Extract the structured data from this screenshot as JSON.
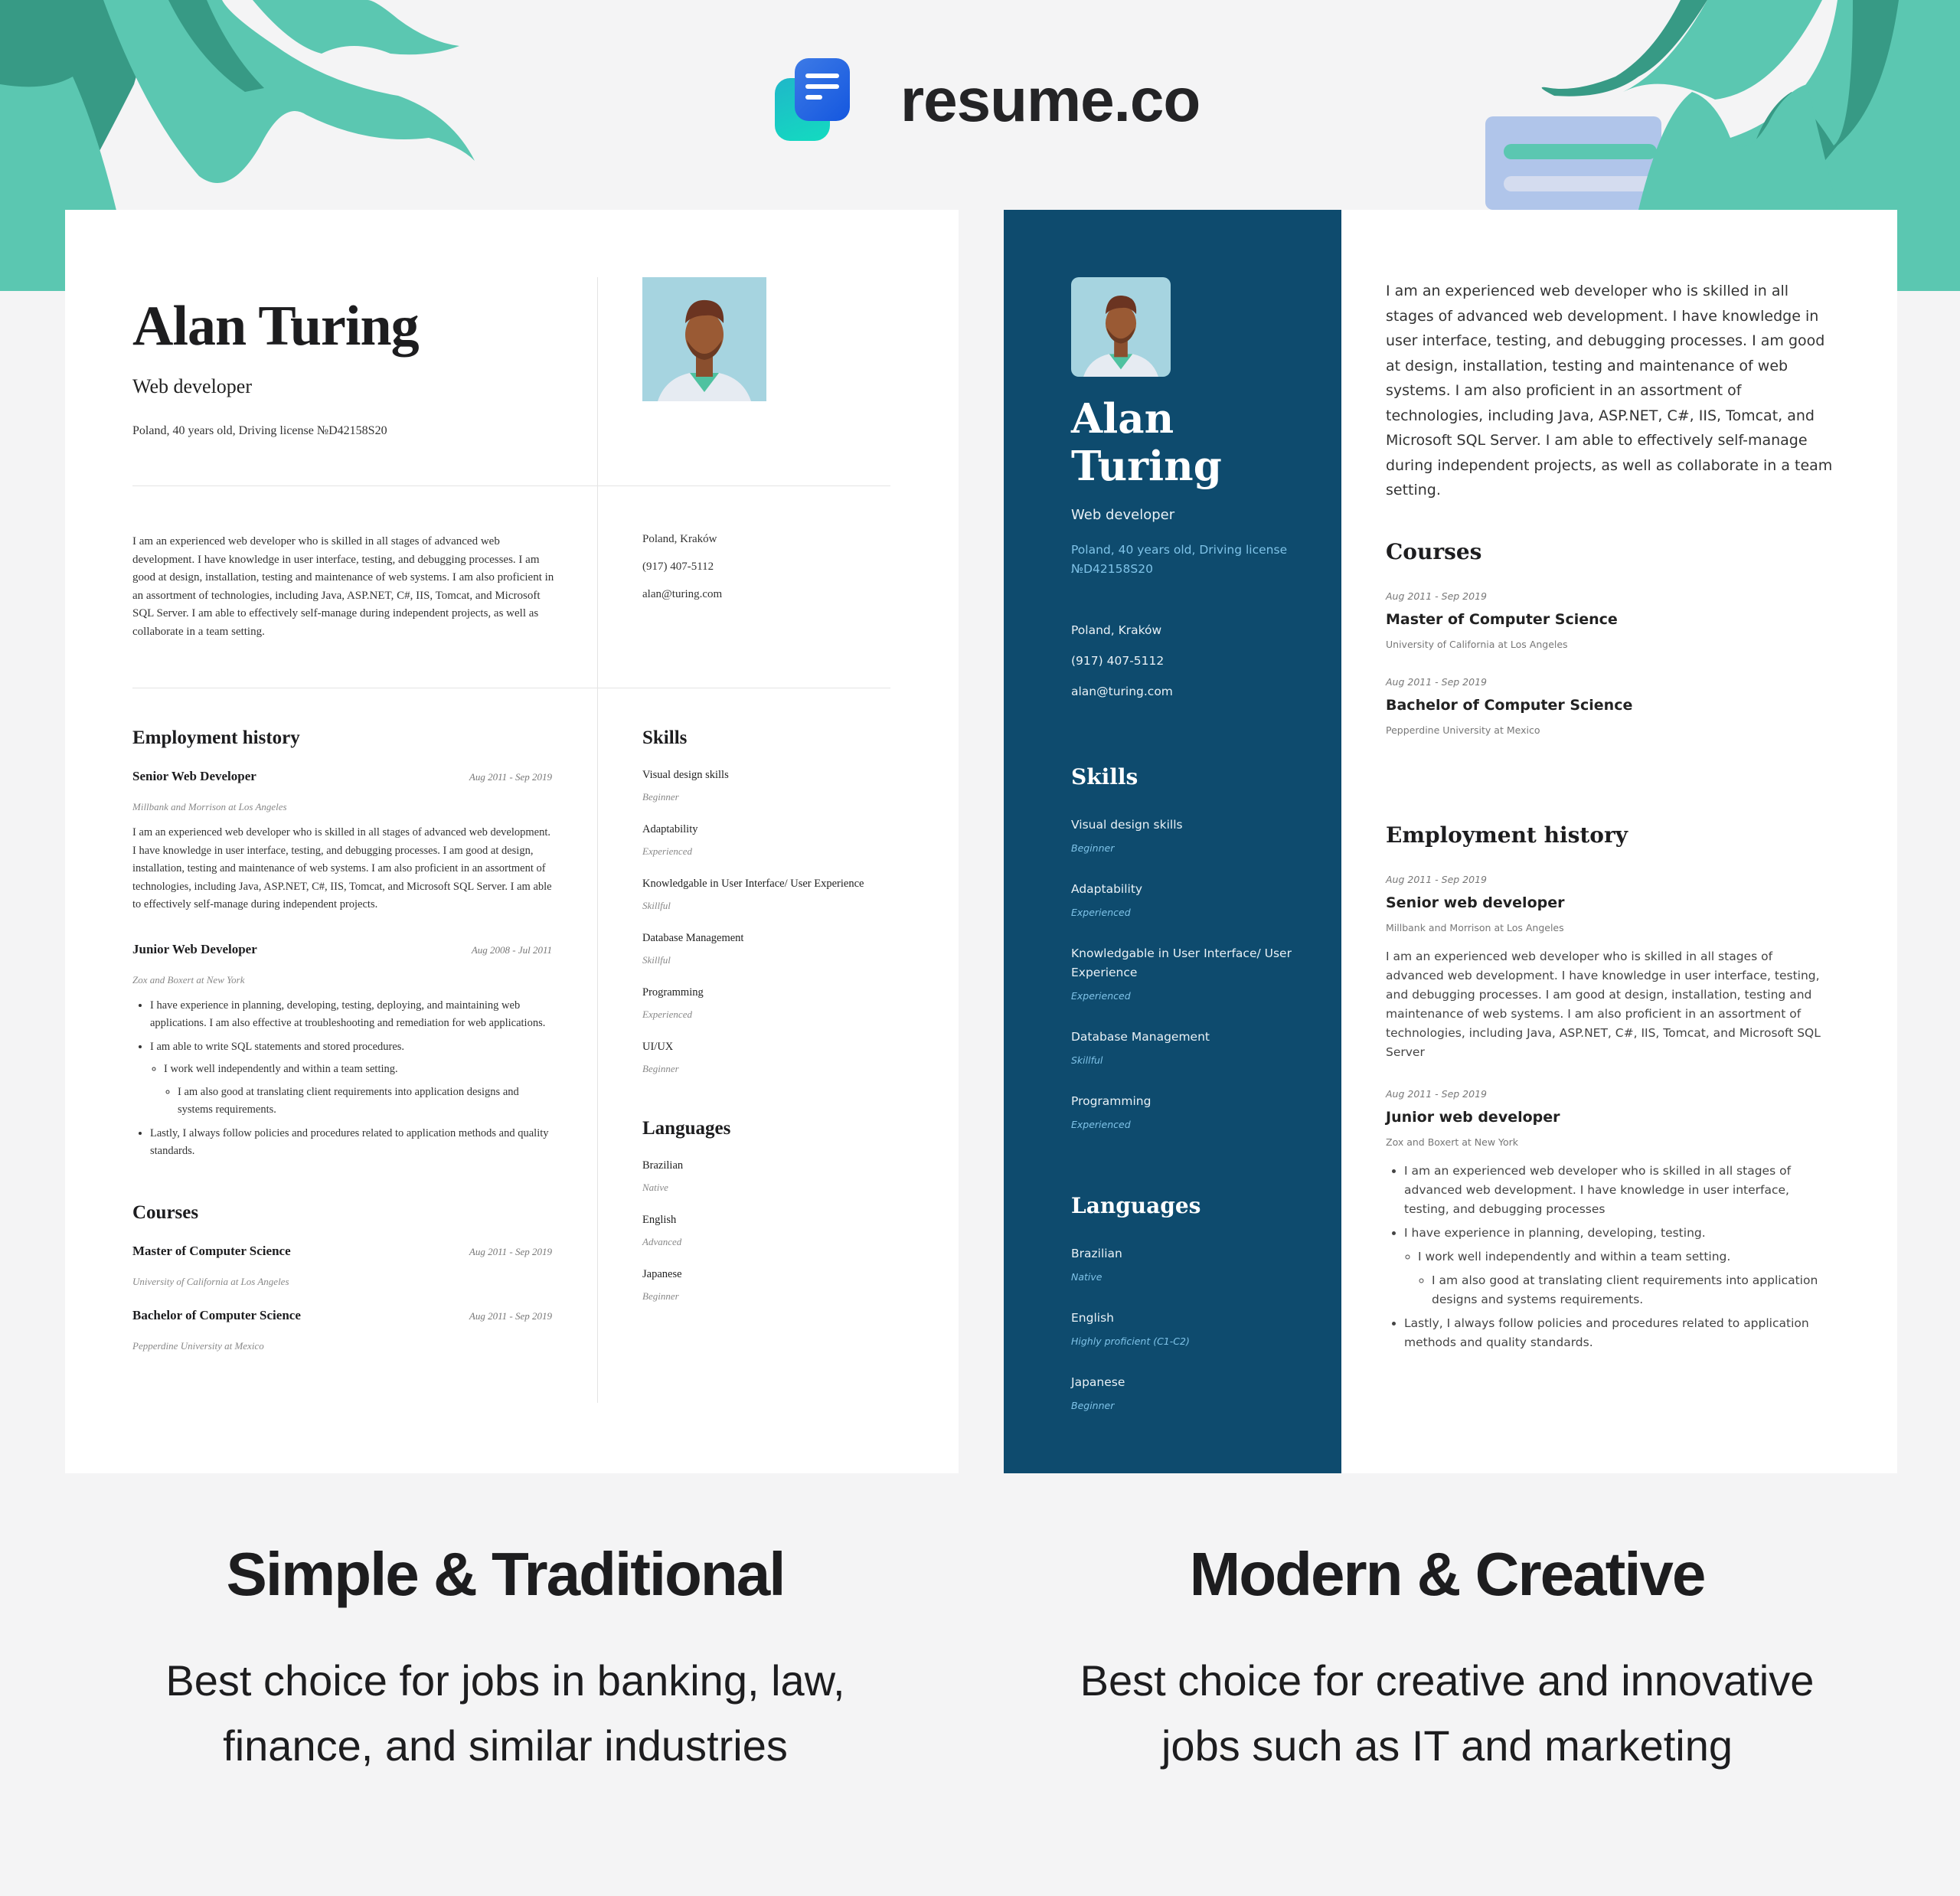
{
  "brand": {
    "name": "resume.co",
    "icon": "resume-logo-icon"
  },
  "colors": {
    "teal": "#5bc7b1",
    "teal_dark": "#379a85",
    "navy": "#0e4b6e",
    "sidebar_accent": "#7fc3e8",
    "logo_blue": "#1457df",
    "logo_cyan": "#13dbc0",
    "bg": "#f4f4f5"
  },
  "traditional": {
    "name": "Alan Turing",
    "role": "Web developer",
    "meta": "Poland, 40 years old, Driving license №D42158S20",
    "summary": "I am an experienced web developer who is skilled in all stages of advanced web development. I have knowledge in user interface, testing, and debugging processes. I am good at design, installation, testing and maintenance of web systems. I am also proficient in an assortment of technologies, including Java, ASP.NET, C#, IIS, Tomcat, and Microsoft SQL Server. I am able to effectively self-manage during independent projects, as well as collaborate in a team setting.",
    "contact": [
      "Poland, Kraków",
      "(917) 407-5112",
      "alan@turing.com"
    ],
    "employment_heading": "Employment history",
    "jobs": [
      {
        "title": "Senior Web Developer",
        "dates": "Aug 2011 - Sep 2019",
        "company": "Millbank and Morrison at Los Angeles",
        "body": "I am an experienced web developer who is skilled in all stages of advanced web development. I have knowledge in user interface, testing, and debugging processes. I am good at design, installation, testing and maintenance of web systems. I am also proficient in an assortment of technologies, including Java, ASP.NET, C#, IIS, Tomcat, and Microsoft SQL Server. I am able to effectively self-manage during independent projects."
      },
      {
        "title": "Junior Web Developer",
        "dates": "Aug 2008 - Jul 2011",
        "company": "Zox and Boxert at New York",
        "bullets": [
          "I have experience in planning, developing, testing, deploying, and maintaining web applications. I am also effective at troubleshooting and remediation for web applications.",
          "I am able to write SQL statements and stored procedures.",
          "I work well independently and within a team setting.",
          "I am also good at translating client requirements into application designs and systems requirements.",
          "Lastly, I always follow policies and procedures related to application methods and quality standards."
        ]
      }
    ],
    "courses_heading": "Courses",
    "courses": [
      {
        "title": "Master of Computer Science",
        "dates": "Aug 2011 - Sep 2019",
        "school": "University of California at Los Angeles"
      },
      {
        "title": "Bachelor of Computer Science",
        "dates": "Aug 2011 - Sep 2019",
        "school": "Pepperdine University at Mexico"
      }
    ],
    "skills_heading": "Skills",
    "skills": [
      {
        "name": "Visual design skills",
        "level": "Beginner"
      },
      {
        "name": "Adaptability",
        "level": "Experienced"
      },
      {
        "name": "Knowledgable in User Interface/ User Experience",
        "level": "Skillful"
      },
      {
        "name": "Database Management",
        "level": "Skillful"
      },
      {
        "name": "Programming",
        "level": "Experienced"
      },
      {
        "name": "UI/UX",
        "level": "Beginner"
      }
    ],
    "languages_heading": "Languages",
    "languages": [
      {
        "name": "Brazilian",
        "level": "Native"
      },
      {
        "name": "English",
        "level": "Advanced"
      },
      {
        "name": "Japanese",
        "level": "Beginner"
      }
    ]
  },
  "modern": {
    "name_first": "Alan",
    "name_last": "Turing",
    "role": "Web developer",
    "meta": "Poland, 40 years old, Driving license №D42158S20",
    "contact": [
      "Poland, Kraków",
      "(917) 407-5112",
      "alan@turing.com"
    ],
    "skills_heading": "Skills",
    "skills": [
      {
        "name": "Visual design skills",
        "level": "Beginner"
      },
      {
        "name": "Adaptability",
        "level": "Experienced"
      },
      {
        "name": "Knowledgable in User Interface/ User Experience",
        "level": "Experienced"
      },
      {
        "name": "Database Management",
        "level": "Skillful"
      },
      {
        "name": "Programming",
        "level": "Experienced"
      }
    ],
    "languages_heading": "Languages",
    "languages": [
      {
        "name": "Brazilian",
        "level": "Native"
      },
      {
        "name": "English",
        "level": "Highly proficient (C1-C2)"
      },
      {
        "name": "Japanese",
        "level": "Beginner"
      }
    ],
    "summary": "I am an experienced web developer who is skilled in all stages of advanced web development. I have knowledge in user interface, testing, and debugging processes. I am good at design, installation, testing and maintenance of web systems. I am also proficient in an assortment of technologies, including Java, ASP.NET, C#, IIS, Tomcat, and Microsoft SQL Server. I am able to effectively self-manage during independent projects, as well as collaborate in a team setting.",
    "courses_heading": "Courses",
    "courses": [
      {
        "dates": "Aug 2011 - Sep 2019",
        "title": "Master of Computer Science",
        "school": "University of California at Los Angeles"
      },
      {
        "dates": "Aug 2011 - Sep 2019",
        "title": "Bachelor of Computer Science",
        "school": "Pepperdine University at Mexico"
      }
    ],
    "employment_heading": "Employment history",
    "jobs": [
      {
        "dates": "Aug 2011 - Sep 2019",
        "title": "Senior web developer",
        "company": "Millbank and Morrison at Los Angeles",
        "body": "I am an experienced web developer who is skilled in all stages of advanced web development. I have knowledge in user interface, testing, and debugging processes. I am good at design, installation, testing and maintenance of web systems. I am also proficient in an assortment of technologies, including Java, ASP.NET, C#, IIS, Tomcat, and Microsoft SQL Server"
      },
      {
        "dates": "Aug 2011 - Sep 2019",
        "title": "Junior web developer",
        "company": "Zox and Boxert at New York",
        "bullets": [
          "I am an experienced web developer who is skilled in all stages of advanced web development. I have knowledge in user interface, testing, and debugging processes",
          "I have experience in planning, developing, testing.",
          "I work well independently and within a team setting.",
          "I am also good at translating client requirements into application designs and systems requirements.",
          "Lastly, I always follow policies and procedures related to application methods and quality standards."
        ]
      }
    ]
  },
  "captions": [
    {
      "title": "Simple & Traditional",
      "line1": "Best choice for jobs in banking, law,",
      "line2": "finance, and similar industries"
    },
    {
      "title": "Modern & Creative",
      "line1": "Best choice for creative and innovative",
      "line2": "jobs such as IT and marketing"
    }
  ]
}
